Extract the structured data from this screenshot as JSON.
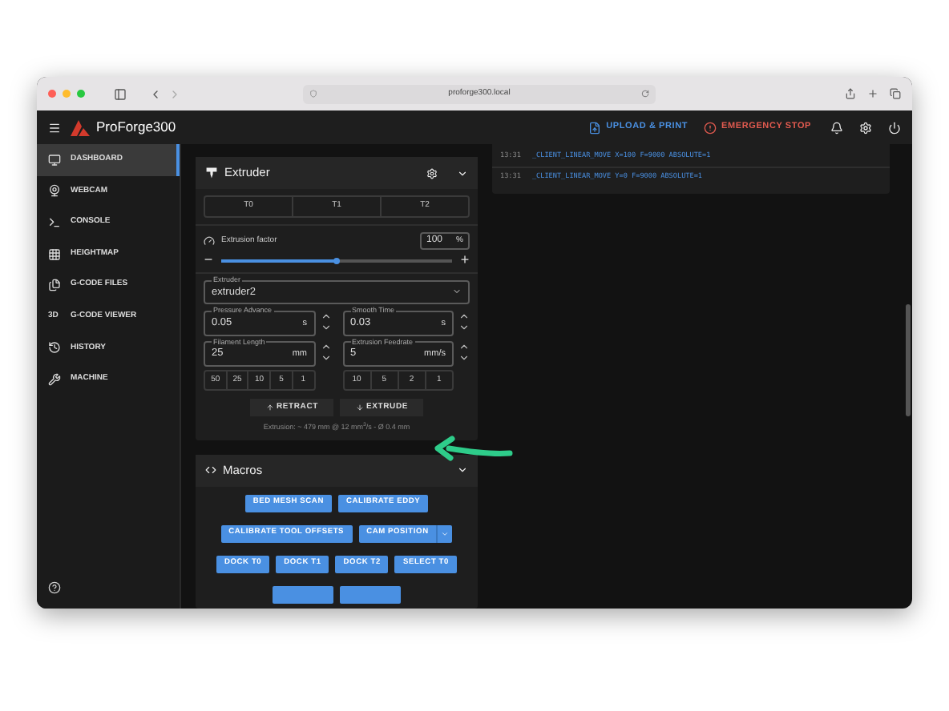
{
  "browser": {
    "url": "proforge300.local"
  },
  "app_bar": {
    "title": "ProForge300",
    "actions": [
      {
        "label": "UPLOAD & PRINT",
        "kind": "upload"
      },
      {
        "label": "EMERGENCY STOP",
        "kind": "stop"
      }
    ]
  },
  "sidebar": {
    "items": [
      {
        "label": "DASHBOARD",
        "selected": true
      },
      {
        "label": "WEBCAM",
        "selected": false
      },
      {
        "label": "CONSOLE",
        "selected": false
      },
      {
        "label": "HEIGHTMAP",
        "selected": false
      },
      {
        "label": "G-CODE FILES",
        "selected": false
      },
      {
        "label": "G-CODE VIEWER",
        "icon_text": "3D",
        "selected": false
      },
      {
        "label": "HISTORY",
        "selected": false
      },
      {
        "label": "MACHINE",
        "selected": false
      }
    ]
  },
  "extruder": {
    "title": "Extruder",
    "tools": [
      "T0",
      "T1",
      "T2"
    ],
    "extrusion_factor": {
      "label": "Extrusion factor",
      "value": "100",
      "unit": "%",
      "level": 0.5,
      "minus": "−",
      "plus": "+"
    },
    "extruder_select": {
      "label": "Extruder",
      "value": "extruder2"
    },
    "fields": [
      {
        "label": "Pressure Advance",
        "value": "0.05",
        "unit": "s"
      },
      {
        "label": "Smooth Time",
        "value": "0.03",
        "unit": "s"
      },
      {
        "label": "Filament Length",
        "value": "25",
        "unit": "mm"
      },
      {
        "label": "Extrusion Feedrate",
        "value": "5",
        "unit": "mm/s"
      }
    ],
    "length_presets": [
      "50",
      "25",
      "10",
      "5",
      "1"
    ],
    "feedrate_presets": [
      "10",
      "5",
      "2",
      "1"
    ],
    "buttons": [
      {
        "label": "RETRACT",
        "kind": "up"
      },
      {
        "label": "EXTRUDE",
        "kind": "down"
      }
    ],
    "info": "Extrusion: ~ 479 mm @ 12 mm$^{3}$/s - Ø 0.4 mm"
  },
  "macros": {
    "title": "Macros",
    "buttons": [
      {
        "label": "BED MESH SCAN",
        "kind": "plain"
      },
      {
        "label": "CALIBRATE EDDY",
        "kind": "plain"
      },
      {
        "label": "CALIBRATE TOOL OFFSETS",
        "kind": "plain"
      },
      {
        "label": "CAM POSITION",
        "kind": "split"
      },
      {
        "label": "DOCK T0",
        "kind": "plain"
      },
      {
        "label": "DOCK T1",
        "kind": "plain"
      },
      {
        "label": "DOCK T2",
        "kind": "plain"
      },
      {
        "label": "SELECT T0",
        "kind": "plain"
      },
      {
        "kind": "blank"
      },
      {
        "kind": "blank"
      }
    ]
  },
  "console": {
    "lines": [
      {
        "time": "13:31",
        "text": "_CLIENT_LINEAR_MOVE X=100 F=9000 ABSOLUTE=1"
      },
      {
        "time": "13:31",
        "text": "_CLIENT_LINEAR_MOVE Y=0 F=9000 ABSOLUTE=1"
      }
    ]
  }
}
